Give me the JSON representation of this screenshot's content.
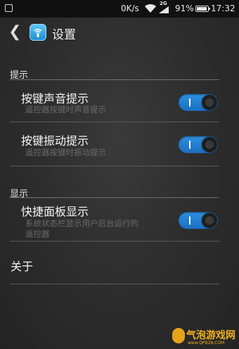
{
  "status_bar": {
    "net_speed": "0K/s",
    "signal_tag": "2G",
    "battery_percent": "91%",
    "battery_level": 0.91,
    "time": "17:32"
  },
  "header": {
    "title": "设置"
  },
  "sections": [
    {
      "header": "提示",
      "items": [
        {
          "title": "按键声音提示",
          "subtitle": "遥控器按键时声音提示",
          "enabled": true
        },
        {
          "title": "按键振动提示",
          "subtitle": "遥控器按键时振动提示",
          "enabled": true
        }
      ]
    },
    {
      "header": "显示",
      "items": [
        {
          "title": "快捷面板显示",
          "subtitle_line1": "系统状态栏显示用户后台运行的",
          "subtitle_line2": "遥控器",
          "enabled": true
        }
      ]
    }
  ],
  "about_label": "关于",
  "watermark": {
    "name": "气泡游戏网",
    "url": "www.QPB28.COM"
  },
  "colors": {
    "toggle_on": "#2d8fe0",
    "background": "#2c2c2c",
    "subtitle": "#6b6b6b"
  }
}
